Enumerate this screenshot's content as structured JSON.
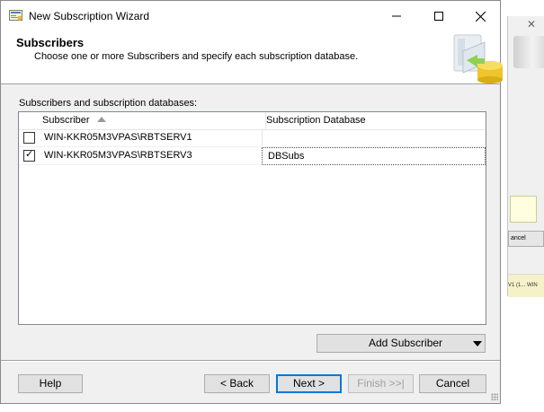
{
  "window": {
    "title": "New Subscription Wizard",
    "app_icon": "wizard-app-icon",
    "controls": [
      "minimize-icon",
      "maximize-icon",
      "close-icon"
    ]
  },
  "header": {
    "title": "Subscribers",
    "subtitle": "Choose one or more Subscribers and specify each subscription database."
  },
  "list": {
    "label": "Subscribers and subscription databases:",
    "columns": [
      "Subscriber",
      "Subscription Database"
    ],
    "sort": "ascending",
    "rows": [
      {
        "checked": false,
        "subscriber": "WIN-KKR05M3VPAS\\RBTSERV1",
        "database": ""
      },
      {
        "checked": true,
        "subscriber": "WIN-KKR05M3VPAS\\RBTSERV3",
        "database": "DBSubs"
      }
    ]
  },
  "buttons": {
    "add_subscriber": "Add Subscriber",
    "help": "Help",
    "back": "< Back",
    "next": "Next >",
    "finish": "Finish >>|",
    "cancel": "Cancel"
  },
  "background_window": {
    "cancel_fragment": "ancel",
    "status_fragment": "V1 (1... WIN"
  },
  "colors": {
    "dialog_bg": "#f0f0f0",
    "default_button_border": "#0078d7",
    "disabled_text": "#a0a0a0"
  }
}
